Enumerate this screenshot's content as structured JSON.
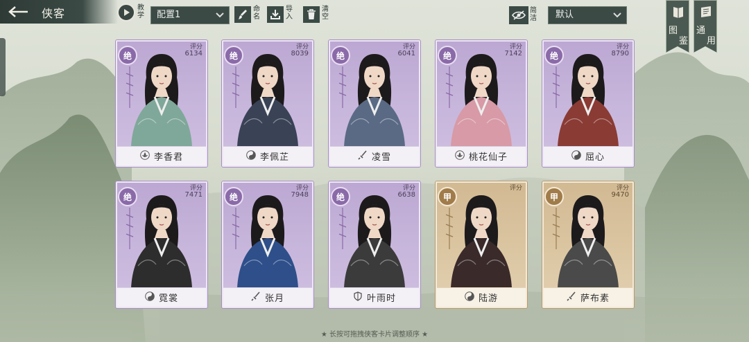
{
  "topbar": {
    "title": "侠客",
    "tutorial_label": "教学",
    "config_value": "配置1",
    "rename_label": "命名",
    "import_label": "导入",
    "clear_label": "清空",
    "filter_label": "简洁",
    "sort_value": "默认",
    "gallery_label_a": "图",
    "gallery_label_b": "鉴",
    "general_label_a": "通",
    "general_label_b": "用"
  },
  "score_label": "评分",
  "cards": [
    {
      "name": "李香君",
      "rarity": "绝",
      "score": "6134",
      "tier": "purple",
      "sect": "lotus-sect-icon"
    },
    {
      "name": "李佩芷",
      "rarity": "绝",
      "score": "8039",
      "tier": "purple",
      "sect": "yinyang-sect-icon"
    },
    {
      "name": "凌雪",
      "rarity": "绝",
      "score": "6041",
      "tier": "purple",
      "sect": "sword-sect-icon"
    },
    {
      "name": "桃花仙子",
      "rarity": "绝",
      "score": "7142",
      "tier": "purple",
      "sect": "lotus-sect-icon"
    },
    {
      "name": "屈心",
      "rarity": "绝",
      "score": "8790",
      "tier": "purple",
      "sect": "yinyang-sect-icon"
    },
    {
      "name": "霓裳",
      "rarity": "绝",
      "score": "7471",
      "tier": "purple",
      "sect": "yinyang-sect-icon"
    },
    {
      "name": "张月",
      "rarity": "绝",
      "score": "7948",
      "tier": "purple",
      "sect": "sword-sect-icon"
    },
    {
      "name": "叶雨时",
      "rarity": "绝",
      "score": "6638",
      "tier": "purple",
      "sect": "shield-sect-icon"
    },
    {
      "name": "陆游",
      "rarity": "甲",
      "score": "",
      "tier": "gold",
      "sect": "yinyang-sect-icon"
    },
    {
      "name": "萨布素",
      "rarity": "甲",
      "score": "9470",
      "tier": "gold",
      "sect": "sword-sect-icon"
    }
  ],
  "hint": "★ 长按可拖拽侠客卡片调整顺序 ★",
  "colors": {
    "bar": "#3b4a45",
    "purple_card": "#c8b8dc",
    "gold_card": "#dbc6a4",
    "rarity_purple": "#8a6aa8",
    "rarity_gold": "#a07c4a"
  }
}
